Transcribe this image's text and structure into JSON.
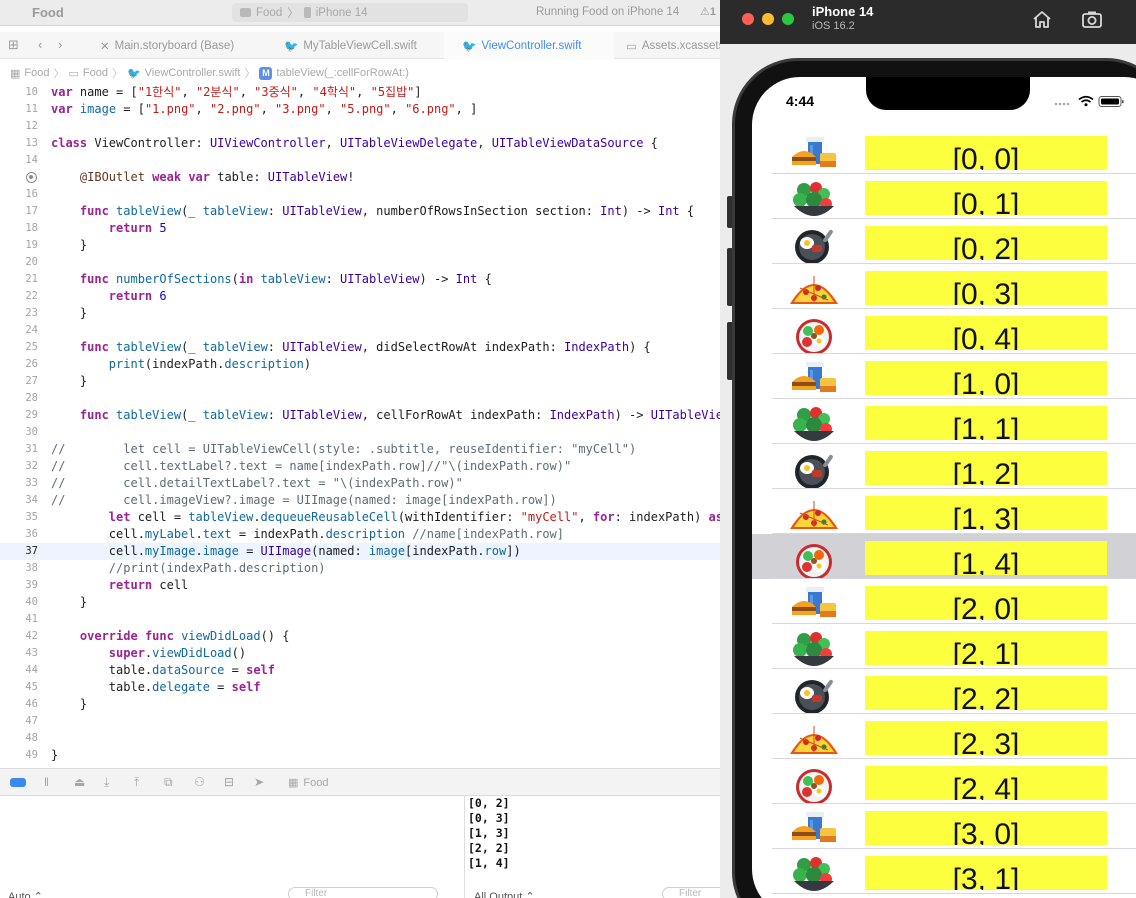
{
  "xcode": {
    "app_title": "Food",
    "scheme": {
      "project": "Food",
      "device": "iPhone 14"
    },
    "run_status": "Running Food on iPhone 14",
    "warning_count": "1",
    "tabs": [
      {
        "label": "Main.storyboard (Base)",
        "icon": "storyboard-icon"
      },
      {
        "label": "MyTableViewCell.swift",
        "icon": "swift-icon"
      },
      {
        "label": "ViewController.swift",
        "icon": "swift-icon",
        "active": true
      },
      {
        "label": "Assets.xcassets",
        "icon": "assets-icon"
      }
    ],
    "breadcrumb": [
      "Food",
      "Food",
      "ViewController.swift",
      "tableView(_:cellForRowAt:)"
    ],
    "accent_color": "#3f8ef0",
    "current_line": 37,
    "breakpoint_line": 15,
    "code_lines": [
      {
        "n": 10,
        "text": "var name = [\"1한식\", \"2분식\", \"3중식\", \"4학식\", \"5집밥\"]"
      },
      {
        "n": 11,
        "text": "var image = [\"1.png\", \"2.png\", \"3.png\", \"5.png\", \"6.png\", ]"
      },
      {
        "n": 12,
        "text": ""
      },
      {
        "n": 13,
        "text": "class ViewController: UIViewController, UITableViewDelegate, UITableViewDataSource {"
      },
      {
        "n": 14,
        "text": ""
      },
      {
        "n": 15,
        "text": "    @IBOutlet weak var table: UITableView!"
      },
      {
        "n": 16,
        "text": ""
      },
      {
        "n": 17,
        "text": "    func tableView(_ tableView: UITableView, numberOfRowsInSection section: Int) -> Int {"
      },
      {
        "n": 18,
        "text": "        return 5"
      },
      {
        "n": 19,
        "text": "    }"
      },
      {
        "n": 20,
        "text": ""
      },
      {
        "n": 21,
        "text": "    func numberOfSections(in tableView: UITableView) -> Int {"
      },
      {
        "n": 22,
        "text": "        return 6"
      },
      {
        "n": 23,
        "text": "    }"
      },
      {
        "n": 24,
        "text": ""
      },
      {
        "n": 25,
        "text": "    func tableView(_ tableView: UITableView, didSelectRowAt indexPath: IndexPath) {"
      },
      {
        "n": 26,
        "text": "        print(indexPath.description)"
      },
      {
        "n": 27,
        "text": "    }"
      },
      {
        "n": 28,
        "text": ""
      },
      {
        "n": 29,
        "text": "    func tableView(_ tableView: UITableView, cellForRowAt indexPath: IndexPath) -> UITableViewCell {"
      },
      {
        "n": 30,
        "text": ""
      },
      {
        "n": 31,
        "text": "//        let cell = UITableViewCell(style: .subtitle, reuseIdentifier: \"myCell\")"
      },
      {
        "n": 32,
        "text": "//        cell.textLabel?.text = name[indexPath.row]//\"\\(indexPath.row)\""
      },
      {
        "n": 33,
        "text": "//        cell.detailTextLabel?.text = \"\\(indexPath.row)\""
      },
      {
        "n": 34,
        "text": "//        cell.imageView?.image = UIImage(named: image[indexPath.row])"
      },
      {
        "n": 35,
        "text": "        let cell = tableView.dequeueReusableCell(withIdentifier: \"myCell\", for: indexPath) as! MyTableViewCell"
      },
      {
        "n": 36,
        "text": "        cell.myLabel.text = indexPath.description //name[indexPath.row]"
      },
      {
        "n": 37,
        "text": "        cell.myImage.image = UIImage(named: image[indexPath.row])"
      },
      {
        "n": 38,
        "text": "        //print(indexPath.description)"
      },
      {
        "n": 39,
        "text": "        return cell"
      },
      {
        "n": 40,
        "text": "    }"
      },
      {
        "n": 41,
        "text": ""
      },
      {
        "n": 42,
        "text": "    override func viewDidLoad() {"
      },
      {
        "n": 43,
        "text": "        super.viewDidLoad()"
      },
      {
        "n": 44,
        "text": "        table.dataSource = self"
      },
      {
        "n": 45,
        "text": "        table.delegate = self"
      },
      {
        "n": 46,
        "text": "    }"
      },
      {
        "n": 47,
        "text": ""
      },
      {
        "n": 48,
        "text": ""
      },
      {
        "n": 49,
        "text": "}"
      }
    ],
    "debug_bar": {
      "target": "Food"
    },
    "console_output": [
      "[0, 2]",
      "[0, 3]",
      "[1, 3]",
      "[2, 2]",
      "[1, 4]"
    ],
    "console_footer": {
      "left_select": "Auto ⌃",
      "filter_placeholder": "Filter",
      "right_select": "All Output ⌃"
    }
  },
  "simulator": {
    "device_name": "iPhone 14",
    "os_version": "iOS 16.2",
    "clock": "4:44",
    "selected_row": 9,
    "highlight_color": "#fbff3d",
    "rows": [
      {
        "label": "[0, 0]",
        "food": "fast-food-icon"
      },
      {
        "label": "[0, 1]",
        "food": "salad-icon"
      },
      {
        "label": "[0, 2]",
        "food": "frying-pan-icon"
      },
      {
        "label": "[0, 3]",
        "food": "pizza-icon"
      },
      {
        "label": "[0, 4]",
        "food": "bibimbap-icon"
      },
      {
        "label": "[1, 0]",
        "food": "fast-food-icon"
      },
      {
        "label": "[1, 1]",
        "food": "salad-icon"
      },
      {
        "label": "[1, 2]",
        "food": "frying-pan-icon"
      },
      {
        "label": "[1, 3]",
        "food": "pizza-icon"
      },
      {
        "label": "[1, 4]",
        "food": "bibimbap-icon"
      },
      {
        "label": "[2, 0]",
        "food": "fast-food-icon"
      },
      {
        "label": "[2, 1]",
        "food": "salad-icon"
      },
      {
        "label": "[2, 2]",
        "food": "frying-pan-icon"
      },
      {
        "label": "[2, 3]",
        "food": "pizza-icon"
      },
      {
        "label": "[2, 4]",
        "food": "bibimbap-icon"
      },
      {
        "label": "[3, 0]",
        "food": "fast-food-icon"
      },
      {
        "label": "[3, 1]",
        "food": "salad-icon"
      }
    ]
  }
}
